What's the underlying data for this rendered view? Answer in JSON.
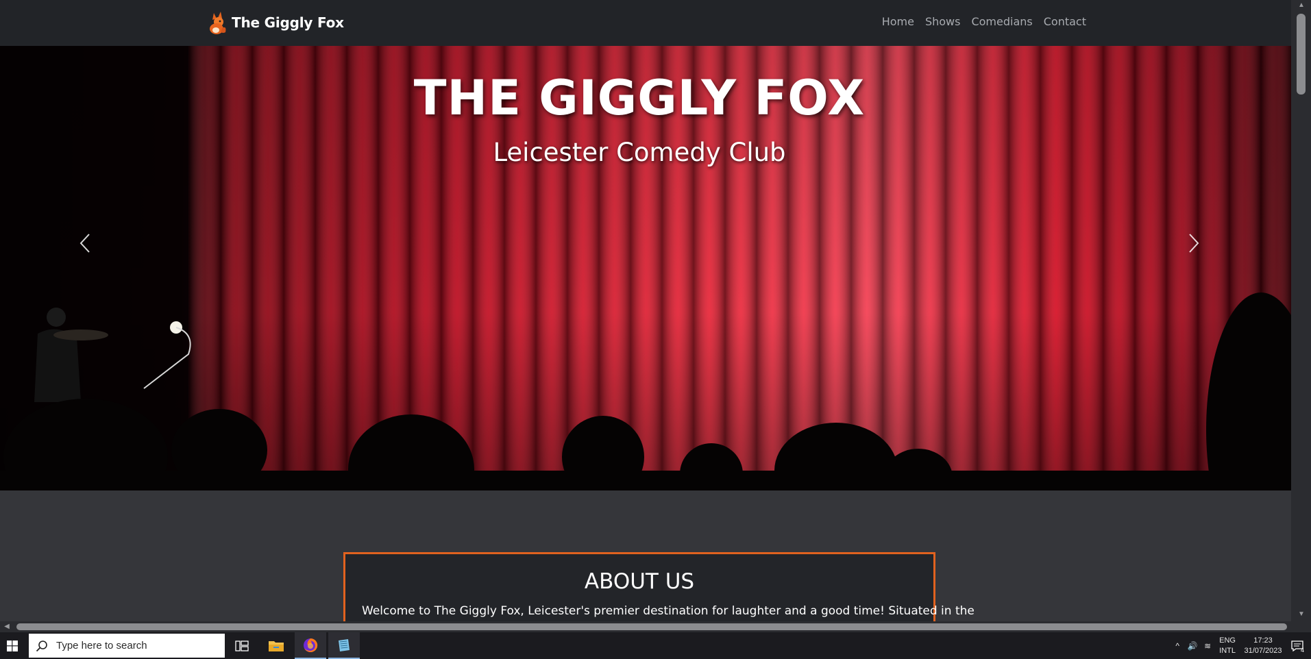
{
  "navbar": {
    "brand_name": "The Giggly Fox",
    "links": [
      "Home",
      "Shows",
      "Comedians",
      "Contact"
    ]
  },
  "hero": {
    "title": "THE GIGGLY FOX",
    "subtitle": "Leicester Comedy Club"
  },
  "about": {
    "title": "ABOUT US",
    "text": "Welcome to The Giggly Fox, Leicester's premier destination for laughter and a good time! Situated in the"
  },
  "taskbar": {
    "search_placeholder": "Type here to search",
    "lang_line1": "ENG",
    "lang_line2": "INTL",
    "time": "17:23",
    "date": "31/07/2023",
    "notification_count": "4"
  },
  "colors": {
    "navbar_bg": "#222428",
    "page_bg": "#35363a",
    "accent_orange": "#e1621f",
    "curtain_red": "#d4122e"
  },
  "icons": {
    "brand": "fox-logo-icon",
    "prev": "chevron-left-icon",
    "next": "chevron-right-icon",
    "start": "windows-start-icon",
    "search": "search-icon",
    "task_view": "task-view-icon",
    "explorer": "file-explorer-icon",
    "firefox": "firefox-icon",
    "app": "notepad-app-icon"
  }
}
